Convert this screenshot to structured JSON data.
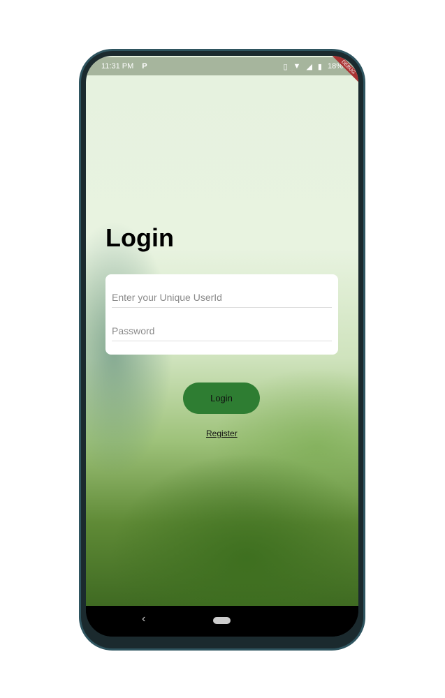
{
  "status_bar": {
    "time": "11:31 PM",
    "app_icon": "P",
    "battery": "18%",
    "debug_banner": "DEBUG"
  },
  "login": {
    "title": "Login",
    "userid_placeholder": "Enter your Unique UserId",
    "password_placeholder": "Password",
    "login_button": "Login",
    "register_link": "Register"
  },
  "nav": {
    "back": "‹"
  }
}
